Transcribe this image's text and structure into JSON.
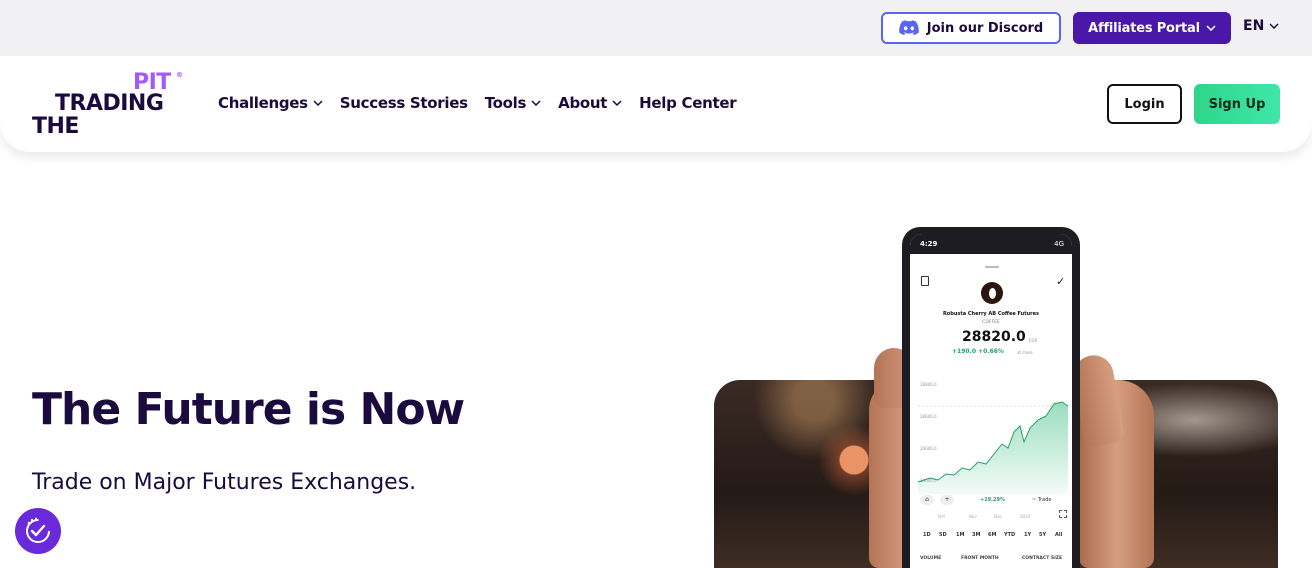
{
  "topbar": {
    "discord_label": "Join our Discord",
    "affiliates_label": "Affiliates Portal",
    "language": "EN"
  },
  "logo": {
    "line1": "PIT",
    "line2": "TRADING",
    "line3": "THE",
    "reg": "®"
  },
  "nav": {
    "items": [
      {
        "label": "Challenges",
        "has_dropdown": true
      },
      {
        "label": "Success Stories",
        "has_dropdown": false
      },
      {
        "label": "Tools",
        "has_dropdown": true
      },
      {
        "label": "About",
        "has_dropdown": true
      },
      {
        "label": "Help Center",
        "has_dropdown": false
      }
    ]
  },
  "auth": {
    "login_label": "Login",
    "signup_label": "Sign Up"
  },
  "hero": {
    "title": "The Future is Now",
    "subtitle": "Trade on Major Futures Exchanges."
  },
  "phone": {
    "time": "4:29",
    "network": "4G",
    "contract_name": "Robusta Cherry AB Coffee Futures",
    "contract_code": "COFFEE",
    "price": "28820.0",
    "price_unit": "EUR",
    "change": "+190.0 +0.66%",
    "change_note": "at close",
    "y_ticks": [
      "28800.0",
      "28600.0",
      "26600.0",
      "24600.0"
    ],
    "period_change": "+19.29%",
    "trade_label": "Trade",
    "months": [
      "Oct",
      "Nov",
      "Dec",
      "2024"
    ],
    "ranges": [
      "1D",
      "5D",
      "1M",
      "3M",
      "6M",
      "YTD",
      "1Y",
      "5Y",
      "All"
    ],
    "footer": [
      "VOLUME",
      "FRONT MONTH",
      "CONTRACT SIZE"
    ]
  },
  "colors": {
    "brand_dark": "#1b0a3d",
    "brand_purple": "#4a18a8",
    "accent_purple": "#a259ff",
    "discord_blue": "#5865f2",
    "signup_green": "#2ed68a",
    "chart_green": "#21a06a"
  }
}
